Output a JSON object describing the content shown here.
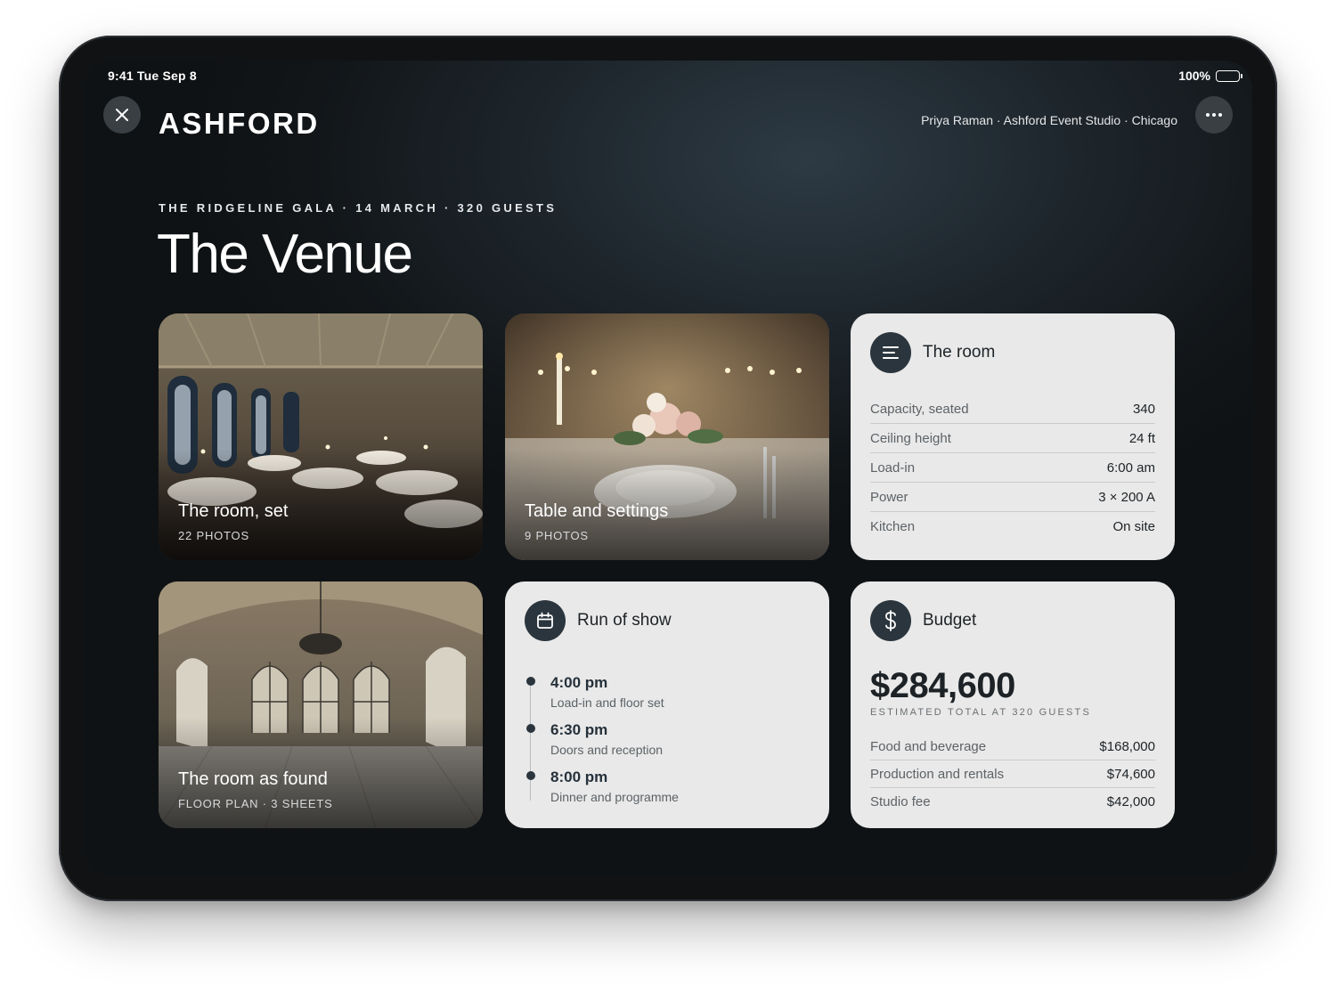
{
  "status": {
    "time": "9:41  Tue Sep 8",
    "battery": "100%"
  },
  "header": {
    "brand": "ASHFORD",
    "user_meta": "Priya Raman · Ashford Event Studio · Chicago"
  },
  "event": {
    "eyebrow": "THE RIDGELINE GALA · 14 MARCH · 320 GUESTS",
    "title": "The Venue"
  },
  "photos": [
    {
      "title": "The room, set",
      "subtitle": "22 PHOTOS"
    },
    {
      "title": "Table and settings",
      "subtitle": "9 PHOTOS"
    },
    {
      "title": "The room as found",
      "subtitle": "FLOOR PLAN · 3 SHEETS"
    }
  ],
  "room": {
    "title": "The room",
    "icon": "list-icon",
    "specs": [
      {
        "label": "Capacity, seated",
        "value": "340"
      },
      {
        "label": "Ceiling height",
        "value": "24 ft"
      },
      {
        "label": "Load-in",
        "value": "6:00 am"
      },
      {
        "label": "Power",
        "value": "3 × 200 A"
      },
      {
        "label": "Kitchen",
        "value": "On site"
      }
    ]
  },
  "run_of_show": {
    "title": "Run of show",
    "icon": "calendar-icon",
    "items": [
      {
        "time": "4:00 pm",
        "desc": "Load-in and floor set"
      },
      {
        "time": "6:30 pm",
        "desc": "Doors and reception"
      },
      {
        "time": "8:00 pm",
        "desc": "Dinner and programme"
      }
    ]
  },
  "budget": {
    "title": "Budget",
    "icon": "dollar-icon",
    "total": "$284,600",
    "caption": "ESTIMATED TOTAL AT 320 GUESTS",
    "lines": [
      {
        "label": "Food and beverage",
        "value": "$168,000"
      },
      {
        "label": "Production and rentals",
        "value": "$74,600"
      },
      {
        "label": "Studio fee",
        "value": "$42,000"
      }
    ]
  },
  "colors": {
    "card_bg": "#e9e9e9",
    "icon_bg": "#2b353d",
    "screen_bg": "#1d252b"
  }
}
